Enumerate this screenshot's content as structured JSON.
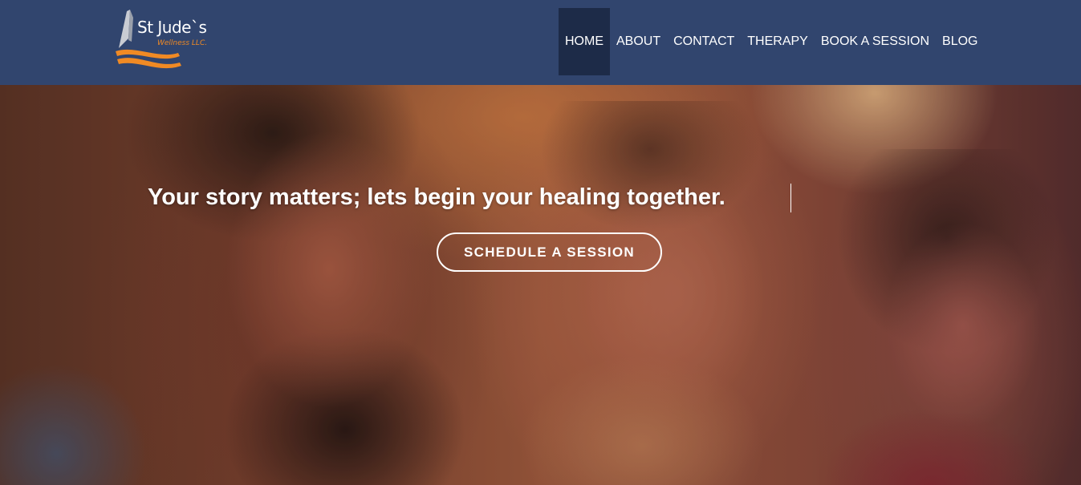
{
  "logo": {
    "title": "St Jude`s",
    "subtitle": "Wellness LLC."
  },
  "nav": {
    "items": [
      {
        "label": "HOME",
        "active": true
      },
      {
        "label": "ABOUT",
        "active": false
      },
      {
        "label": "CONTACT",
        "active": false
      },
      {
        "label": "THERAPY",
        "active": false
      },
      {
        "label": "BOOK A SESSION",
        "active": false
      },
      {
        "label": "BLOG",
        "active": false
      }
    ]
  },
  "hero": {
    "headline": "Your story matters; lets begin your healing together.",
    "cta_label": "SCHEDULE A SESSION"
  },
  "colors": {
    "header_bg": "#31456e",
    "nav_active_bg": "#1d2b48",
    "logo_accent": "#f08a24",
    "text": "#ffffff"
  }
}
